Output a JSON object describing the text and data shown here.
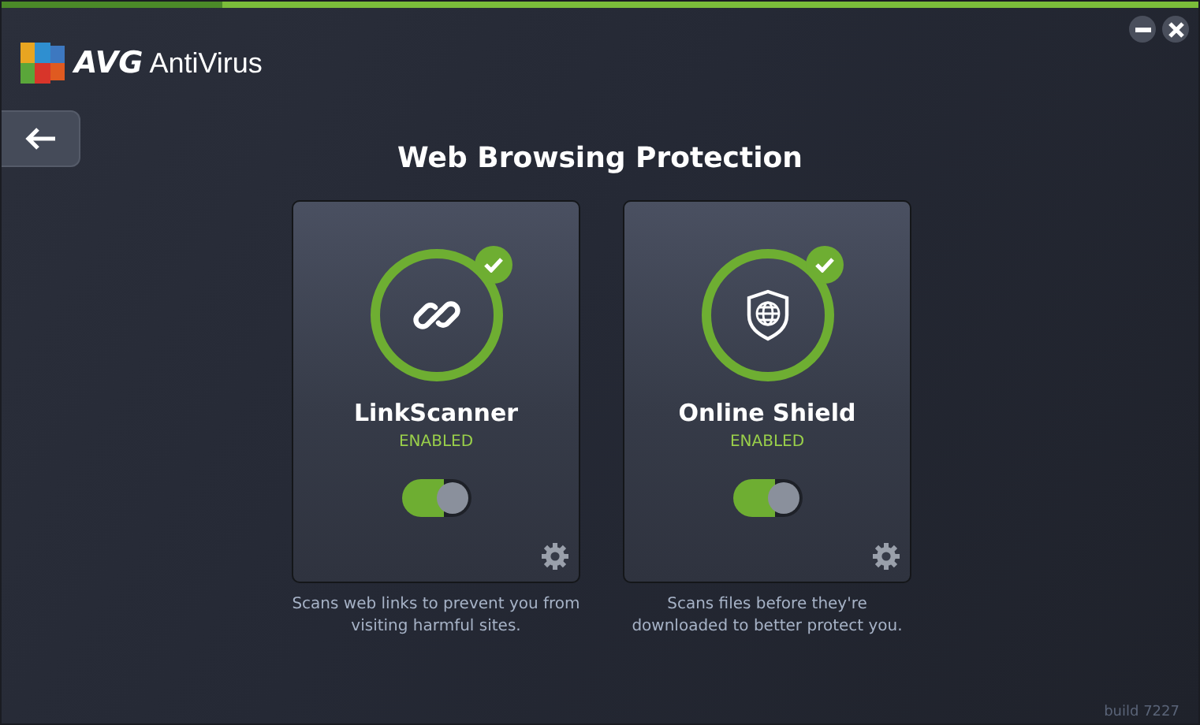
{
  "app": {
    "brand": "AVG",
    "product": "AntiVirus"
  },
  "page": {
    "title": "Web Browsing Protection"
  },
  "components": [
    {
      "kind": "link",
      "name": "LinkScanner",
      "status": "ENABLED",
      "on": true,
      "description": "Scans web links to prevent you from visiting harmful sites."
    },
    {
      "kind": "shield",
      "name": "Online Shield",
      "status": "ENABLED",
      "on": true,
      "description": "Scans files before they're downloaded to better protect you."
    }
  ],
  "build": "build 7227"
}
